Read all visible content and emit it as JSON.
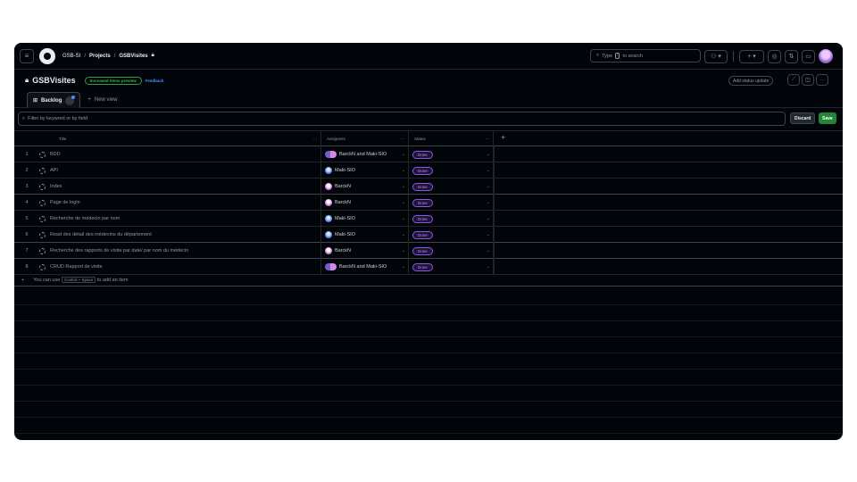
{
  "header": {
    "org": "GSB-SI",
    "sep1": "/",
    "projects": "Projects",
    "sep2": "/",
    "project": "GSBVisites",
    "search_prefix": "Type",
    "search_key": "/",
    "search_suffix": "to search"
  },
  "project": {
    "title": "GSBVisites",
    "badge": "Increased items preview",
    "feedback": "Feedback",
    "status_update": "Add status update",
    "tab_backlog": "Backlog",
    "new_view": "New view"
  },
  "filter": {
    "placeholder": "Filter by keyword or by field",
    "discard": "Discard",
    "save": "Save"
  },
  "columns": {
    "title": "Title",
    "assignees": "Assignees",
    "status": "Status",
    "more": "···",
    "add": "+"
  },
  "rows": [
    {
      "num": "1",
      "title": "BDD",
      "assignee": "BarckN and Maki-SIO",
      "avatar": "pair",
      "status": "Done"
    },
    {
      "num": "2",
      "title": "API",
      "assignee": "Maki-SIO",
      "avatar": "blue",
      "status": "Done"
    },
    {
      "num": "3",
      "title": "Index",
      "assignee": "BarckN",
      "avatar": "pink",
      "status": "Done"
    },
    {
      "num": "4",
      "title": "Page de login",
      "assignee": "BarckN",
      "avatar": "pink",
      "status": "Done"
    },
    {
      "num": "5",
      "title": "Recherche de médecin par nom",
      "assignee": "Maki-SIO",
      "avatar": "blue",
      "status": "Done"
    },
    {
      "num": "6",
      "title": "Read des détail des médecins du département",
      "assignee": "Maki-SIO",
      "avatar": "blue",
      "status": "Done"
    },
    {
      "num": "7",
      "title": "Recherche des rapports de visite par date/ par nom du médecin",
      "assignee": "BarckN",
      "avatar": "pink",
      "status": "Done"
    },
    {
      "num": "8",
      "title": "CRUD Rapport de visite",
      "assignee": "BarckN and Maki-SIO",
      "avatar": "pair",
      "status": "Done"
    }
  ],
  "add_item": {
    "plus": "+",
    "prefix": "You can use",
    "key": "Control + Space",
    "suffix": "to add an item"
  },
  "icons": [
    "hamburger-icon",
    "github-logo-icon",
    "lock-icon",
    "search-icon",
    "copilot-icon",
    "plus-icon",
    "issues-icon",
    "pull-request-icon",
    "inbox-icon",
    "chart-icon",
    "layout-icon",
    "table-icon",
    "filter-search-icon"
  ],
  "colors": {
    "background": "#010409",
    "done": "#8957e5",
    "save": "#238636",
    "badge": "#2ea043"
  }
}
